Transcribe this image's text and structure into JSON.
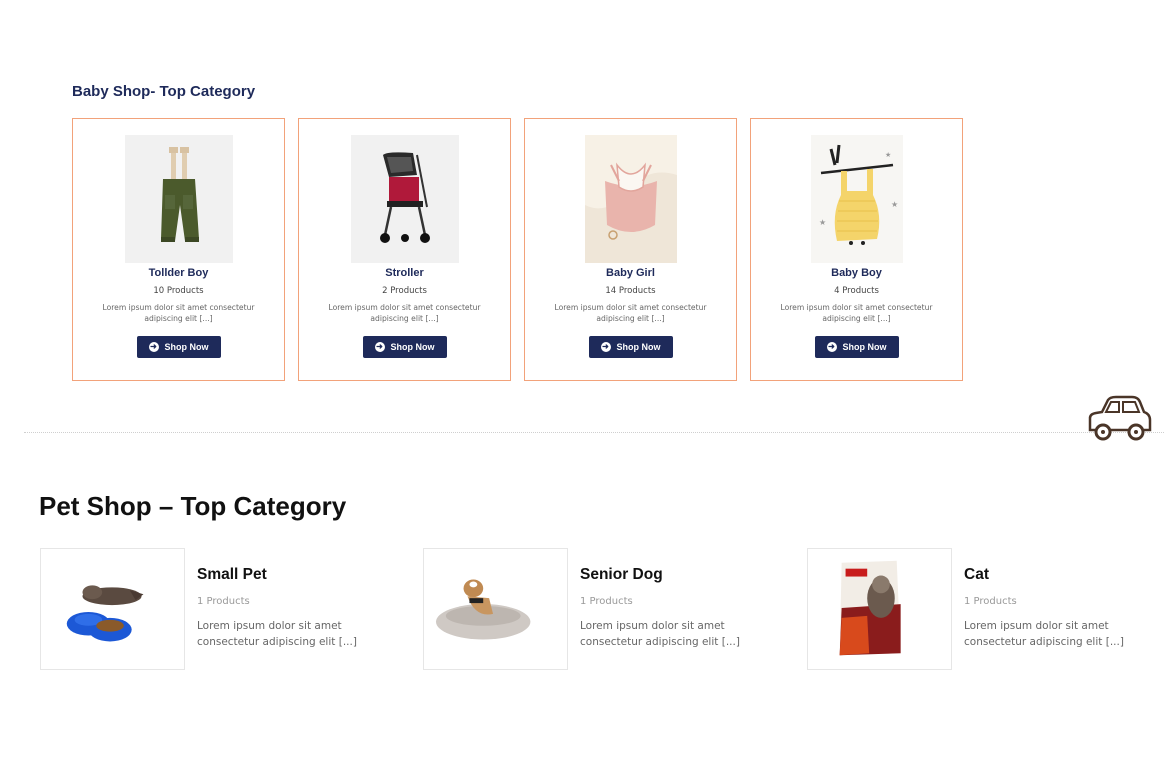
{
  "baby_shop": {
    "title": "Baby Shop- Top Category",
    "button_label": "Shop Now",
    "categories": [
      {
        "name": "Tollder Boy",
        "count": "10 Products",
        "description": "Lorem ipsum dolor sit amet consectetur adipiscing elit [...]",
        "image": "olive-pants-with-suspenders"
      },
      {
        "name": "Stroller",
        "count": "2 Products",
        "description": "Lorem ipsum dolor sit amet consectetur adipiscing elit [...]",
        "image": "baby-stroller"
      },
      {
        "name": "Baby Girl",
        "count": "14 Products",
        "description": "Lorem ipsum dolor sit amet consectetur adipiscing elit [...]",
        "image": "pink-knit-romper"
      },
      {
        "name": "Baby Boy",
        "count": "4 Products",
        "description": "Lorem ipsum dolor sit amet consectetur adipiscing elit [...]",
        "image": "yellow-striped-romper"
      }
    ]
  },
  "pet_shop": {
    "title": "Pet Shop – Top Category",
    "categories": [
      {
        "name": "Small Pet",
        "count": "1 Products",
        "description": "Lorem ipsum dolor sit amet consectetur adipiscing elit [...]",
        "image": "cat-with-food-bowls"
      },
      {
        "name": "Senior Dog",
        "count": "1 Products",
        "description": "Lorem ipsum dolor sit amet consectetur adipiscing elit [...]",
        "image": "dog-in-round-bed"
      },
      {
        "name": "Cat",
        "count": "1 Products",
        "description": "Lorem ipsum dolor sit amet consectetur adipiscing elit [...]",
        "image": "cat-food-bag"
      }
    ]
  },
  "colors": {
    "accent": "#1e2a5a",
    "card_border": "#f2a27a",
    "divider": "#cfcfcf"
  },
  "icons": {
    "button_icon": "arrow-circle-right-icon",
    "divider_icon": "car-icon"
  }
}
